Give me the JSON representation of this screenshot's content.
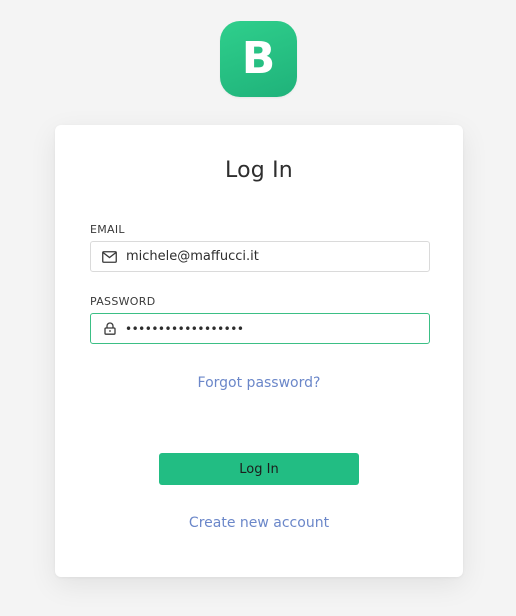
{
  "brand": {
    "logo_letter": "B",
    "color": "#22bd83"
  },
  "form": {
    "title": "Log In",
    "email": {
      "label": "EMAIL",
      "value": "michele@maffucci.it",
      "icon": "mail-icon"
    },
    "password": {
      "label": "PASSWORD",
      "value": "••••••••••••••••••",
      "icon": "lock-icon"
    },
    "forgot_link": "Forgot password?",
    "submit_label": "Log In",
    "create_link": "Create new account"
  },
  "colors": {
    "link": "#6b87c9",
    "button": "#22bd83",
    "focus_border": "#3bbf85",
    "background": "#f4f4f4"
  }
}
